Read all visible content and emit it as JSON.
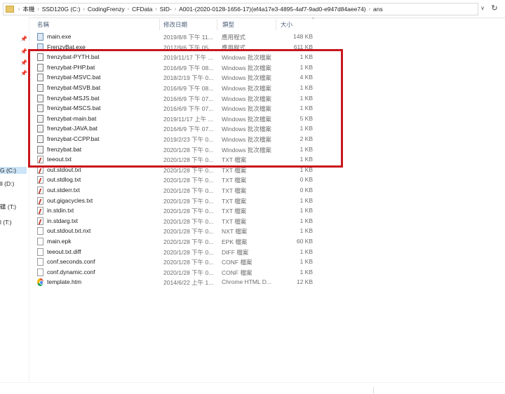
{
  "breadcrumb": [
    "本機",
    "SSD120G (C:)",
    "CodingFrenzy",
    "CFData",
    "SID-",
    "A001-(2020-0128-1656-17)(ef4a17e3-4895-4af7-9ad0-e947d84aee74)",
    "ans"
  ],
  "breadcrumb_separator": "›",
  "address_dropdown": "∨",
  "refresh_glyph": "↻",
  "columns": {
    "name": "名稱",
    "date": "修改日期",
    "type": "類型",
    "size": "大小"
  },
  "nav_drives": [
    "G (C:)",
    "ll (D:)",
    "碟 (T:)",
    "l (T:)"
  ],
  "files": [
    {
      "name": "main.exe",
      "date": "2019/8/8 下午 11...",
      "type": "應用程式",
      "size": "148 KB",
      "icon": "exe-icon"
    },
    {
      "name": "FrenzyBat.exe",
      "date": "2017/9/6 下午 05...",
      "type": "應用程式",
      "size": "611 KB",
      "icon": "exe-icon"
    },
    {
      "name": "frenzybat-PYTH.bat",
      "date": "2019/11/17 下午 ...",
      "type": "Windows 批次檔案",
      "size": "1 KB",
      "icon": "bat-icon"
    },
    {
      "name": "frenzybat-PHP.bat",
      "date": "2016/6/9 下午 08...",
      "type": "Windows 批次檔案",
      "size": "1 KB",
      "icon": "bat-icon"
    },
    {
      "name": "frenzybat-MSVC.bat",
      "date": "2018/2/19 下午 0...",
      "type": "Windows 批次檔案",
      "size": "4 KB",
      "icon": "bat-icon"
    },
    {
      "name": "frenzybat-MSVB.bat",
      "date": "2016/6/9 下午 08...",
      "type": "Windows 批次檔案",
      "size": "1 KB",
      "icon": "bat-icon"
    },
    {
      "name": "frenzybat-MSJS.bat",
      "date": "2016/6/9 下午 07...",
      "type": "Windows 批次檔案",
      "size": "1 KB",
      "icon": "bat-icon"
    },
    {
      "name": "frenzybat-MSCS.bat",
      "date": "2016/6/9 下午 07...",
      "type": "Windows 批次檔案",
      "size": "1 KB",
      "icon": "bat-icon"
    },
    {
      "name": "frenzybat-main.bat",
      "date": "2019/11/17 上午 ...",
      "type": "Windows 批次檔案",
      "size": "5 KB",
      "icon": "bat-icon"
    },
    {
      "name": "frenzybat-JAVA.bat",
      "date": "2016/6/9 下午 07...",
      "type": "Windows 批次檔案",
      "size": "1 KB",
      "icon": "bat-icon"
    },
    {
      "name": "frenzybat-CCPP.bat",
      "date": "2019/2/23 下午 0...",
      "type": "Windows 批次檔案",
      "size": "2 KB",
      "icon": "bat-icon"
    },
    {
      "name": "frenzybat.bat",
      "date": "2020/1/28 下午 0...",
      "type": "Windows 批次檔案",
      "size": "1 KB",
      "icon": "bat-icon"
    },
    {
      "name": "teeout.txt",
      "date": "2020/1/28 下午 0...",
      "type": "TXT 檔案",
      "size": "1 KB",
      "icon": "txt-icon"
    },
    {
      "name": "out.stdout.txt",
      "date": "2020/1/28 下午 0...",
      "type": "TXT 檔案",
      "size": "1 KB",
      "icon": "txt-icon"
    },
    {
      "name": "out.stdlog.txt",
      "date": "2020/1/28 下午 0...",
      "type": "TXT 檔案",
      "size": "0 KB",
      "icon": "txt-icon"
    },
    {
      "name": "out.stderr.txt",
      "date": "2020/1/28 下午 0...",
      "type": "TXT 檔案",
      "size": "0 KB",
      "icon": "txt-icon"
    },
    {
      "name": "out.gigacycles.txt",
      "date": "2020/1/28 下午 0...",
      "type": "TXT 檔案",
      "size": "1 KB",
      "icon": "txt-icon"
    },
    {
      "name": "in.stdin.txt",
      "date": "2020/1/28 下午 0...",
      "type": "TXT 檔案",
      "size": "1 KB",
      "icon": "txt-icon"
    },
    {
      "name": "in.stdarg.txt",
      "date": "2020/1/28 下午 0...",
      "type": "TXT 檔案",
      "size": "1 KB",
      "icon": "txt-icon"
    },
    {
      "name": "out.stdout.txt.nxt",
      "date": "2020/1/28 下午 0...",
      "type": "NXT 檔案",
      "size": "1 KB",
      "icon": "generic-file-icon"
    },
    {
      "name": "main.epk",
      "date": "2020/1/28 下午 0...",
      "type": "EPK 檔案",
      "size": "60 KB",
      "icon": "generic-file-icon"
    },
    {
      "name": "teeout.txt.diff",
      "date": "2020/1/28 下午 0...",
      "type": "DIFF 檔案",
      "size": "1 KB",
      "icon": "generic-file-icon"
    },
    {
      "name": "conf.seconds.conf",
      "date": "2020/1/28 下午 0...",
      "type": "CONF 檔案",
      "size": "1 KB",
      "icon": "generic-file-icon"
    },
    {
      "name": "conf.dynamic.conf",
      "date": "2020/1/28 下午 0...",
      "type": "CONF 檔案",
      "size": "1 KB",
      "icon": "generic-file-icon"
    },
    {
      "name": "template.htm",
      "date": "2014/6/22 上午 1...",
      "type": "Chrome HTML D...",
      "size": "12 KB",
      "icon": "chrome-icon"
    }
  ],
  "colors": {
    "highlight_box": "#c8161d",
    "header_text": "#4c607a",
    "selected_drive": "#cce4f7"
  }
}
